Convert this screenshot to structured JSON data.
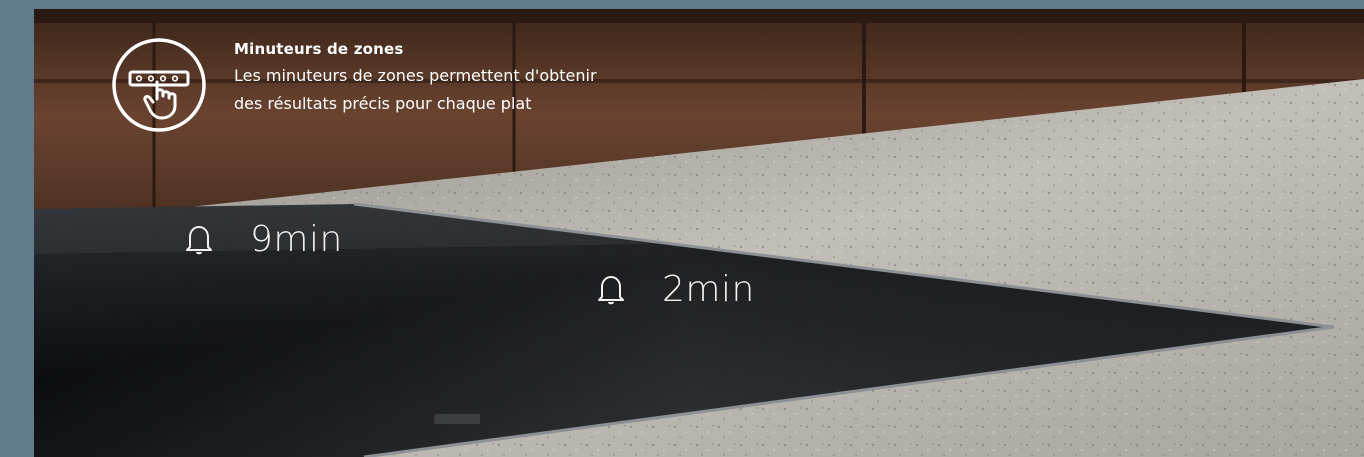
{
  "feature": {
    "title": "Minuteurs de zones",
    "description_line1": "Les minuteurs de zones permettent d'obtenir",
    "description_line2": "des résultats précis pour chaque plat",
    "icon": "touch-panel-icon"
  },
  "timers": [
    {
      "label": "9min",
      "icon": "bell-icon"
    },
    {
      "label": "2min",
      "icon": "bell-icon"
    }
  ],
  "colors": {
    "frame": "#5f7b8c",
    "cabinet_wood": "#5a3a28",
    "countertop": "#b9b6b0",
    "cooktop_glass": "#141618",
    "text": "#ffffff"
  }
}
